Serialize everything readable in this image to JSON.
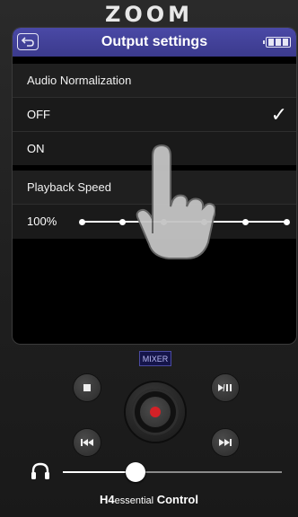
{
  "brand": {
    "logo_text": "ZOOM"
  },
  "header": {
    "title": "Output settings",
    "back_icon": "back-arrow-icon",
    "battery_icon": "battery-full-icon"
  },
  "audio_normalization": {
    "heading": "Audio Normalization",
    "options": [
      {
        "label": "OFF",
        "selected": true
      },
      {
        "label": "ON",
        "selected": false
      }
    ],
    "check_mark": "✓"
  },
  "playback_speed": {
    "heading": "Playback Speed",
    "value_label": "100%",
    "steps": 6,
    "selected_step": 2
  },
  "controls": {
    "mixer_label": "MIXER",
    "stop_icon": "stop-icon",
    "play_pause_icon": "play-pause-icon",
    "rewind_icon": "rewind-icon",
    "fast_forward_icon": "fast-forward-icon",
    "record_icon": "record-icon",
    "record_color": "#d32127"
  },
  "volume": {
    "headphone_icon": "headphone-icon",
    "level": 0.33
  },
  "footer": {
    "model_bold": "H4",
    "model_small": "essential",
    "suffix": "Control"
  },
  "colors": {
    "header": "#3b3a8c",
    "accent_mixer": "#4a4aa0"
  }
}
